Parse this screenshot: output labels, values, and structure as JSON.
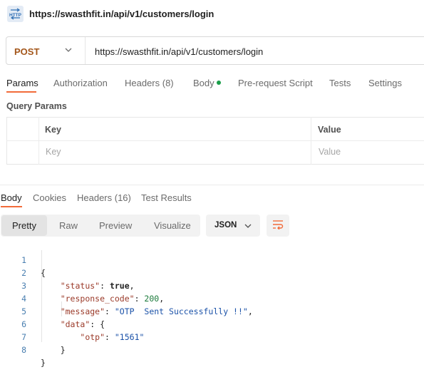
{
  "header": {
    "icon": "http-icon",
    "icon_text": "HTTP",
    "title": "https://swasthfit.in/api/v1/customers/login"
  },
  "request": {
    "method": "POST",
    "url": "https://swasthfit.in/api/v1/customers/login",
    "method_color": "#a3561a"
  },
  "request_tabs": [
    {
      "label": "Params",
      "active": true
    },
    {
      "label": "Authorization"
    },
    {
      "label": "Headers (8)"
    },
    {
      "label": "Body",
      "has_dot": true
    },
    {
      "label": "Pre-request Script"
    },
    {
      "label": "Tests"
    },
    {
      "label": "Settings"
    }
  ],
  "query_params": {
    "title": "Query Params",
    "columns": [
      "Key",
      "Value"
    ],
    "placeholder_row": [
      "Key",
      "Value"
    ]
  },
  "response_tabs": [
    {
      "label": "Body",
      "active": true
    },
    {
      "label": "Cookies"
    },
    {
      "label": "Headers (16)"
    },
    {
      "label": "Test Results"
    }
  ],
  "view_modes": [
    "Pretty",
    "Raw",
    "Preview",
    "Visualize"
  ],
  "active_view": "Pretty",
  "format": "JSON",
  "accent_color": "#f26b3a",
  "response_body": {
    "line_numbers": [
      "1",
      "2",
      "3",
      "4",
      "5",
      "6",
      "7",
      "8"
    ],
    "lines": [
      "{",
      "    \"status\": true,",
      "    \"response_code\": 200,",
      "    \"message\": \"OTP  Sent Successfully !!\",",
      "    \"data\": {",
      "        \"otp\": \"1561\"",
      "    }",
      "}"
    ]
  }
}
